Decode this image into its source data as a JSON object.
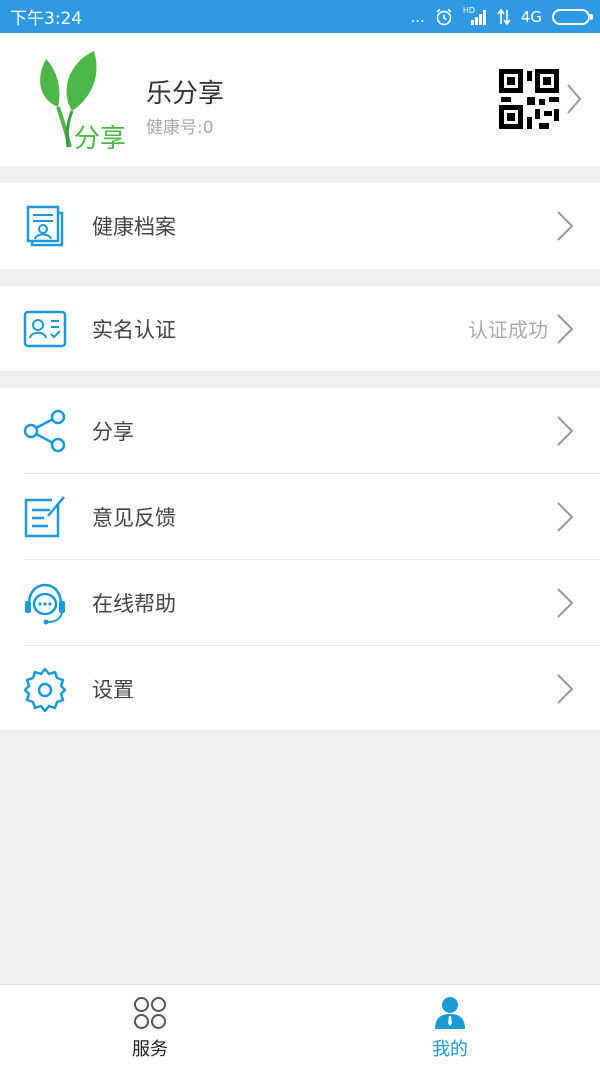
{
  "status_bar": {
    "time": "下午3:24",
    "dots": "...",
    "network": "4G",
    "hd": "HD"
  },
  "profile": {
    "logo_text": "分享",
    "name": "乐分享",
    "health_id": "健康号:0"
  },
  "menu": {
    "health_records": "健康档案",
    "real_name": "实名认证",
    "real_name_status": "认证成功",
    "share": "分享",
    "feedback": "意见反馈",
    "online_help": "在线帮助",
    "settings": "设置"
  },
  "tabs": {
    "services": "服务",
    "mine": "我的"
  },
  "colors": {
    "accent": "#2e9ae6",
    "icon_blue": "#1a9bd7",
    "background": "#efefef",
    "logo_green": "#4cb848"
  }
}
